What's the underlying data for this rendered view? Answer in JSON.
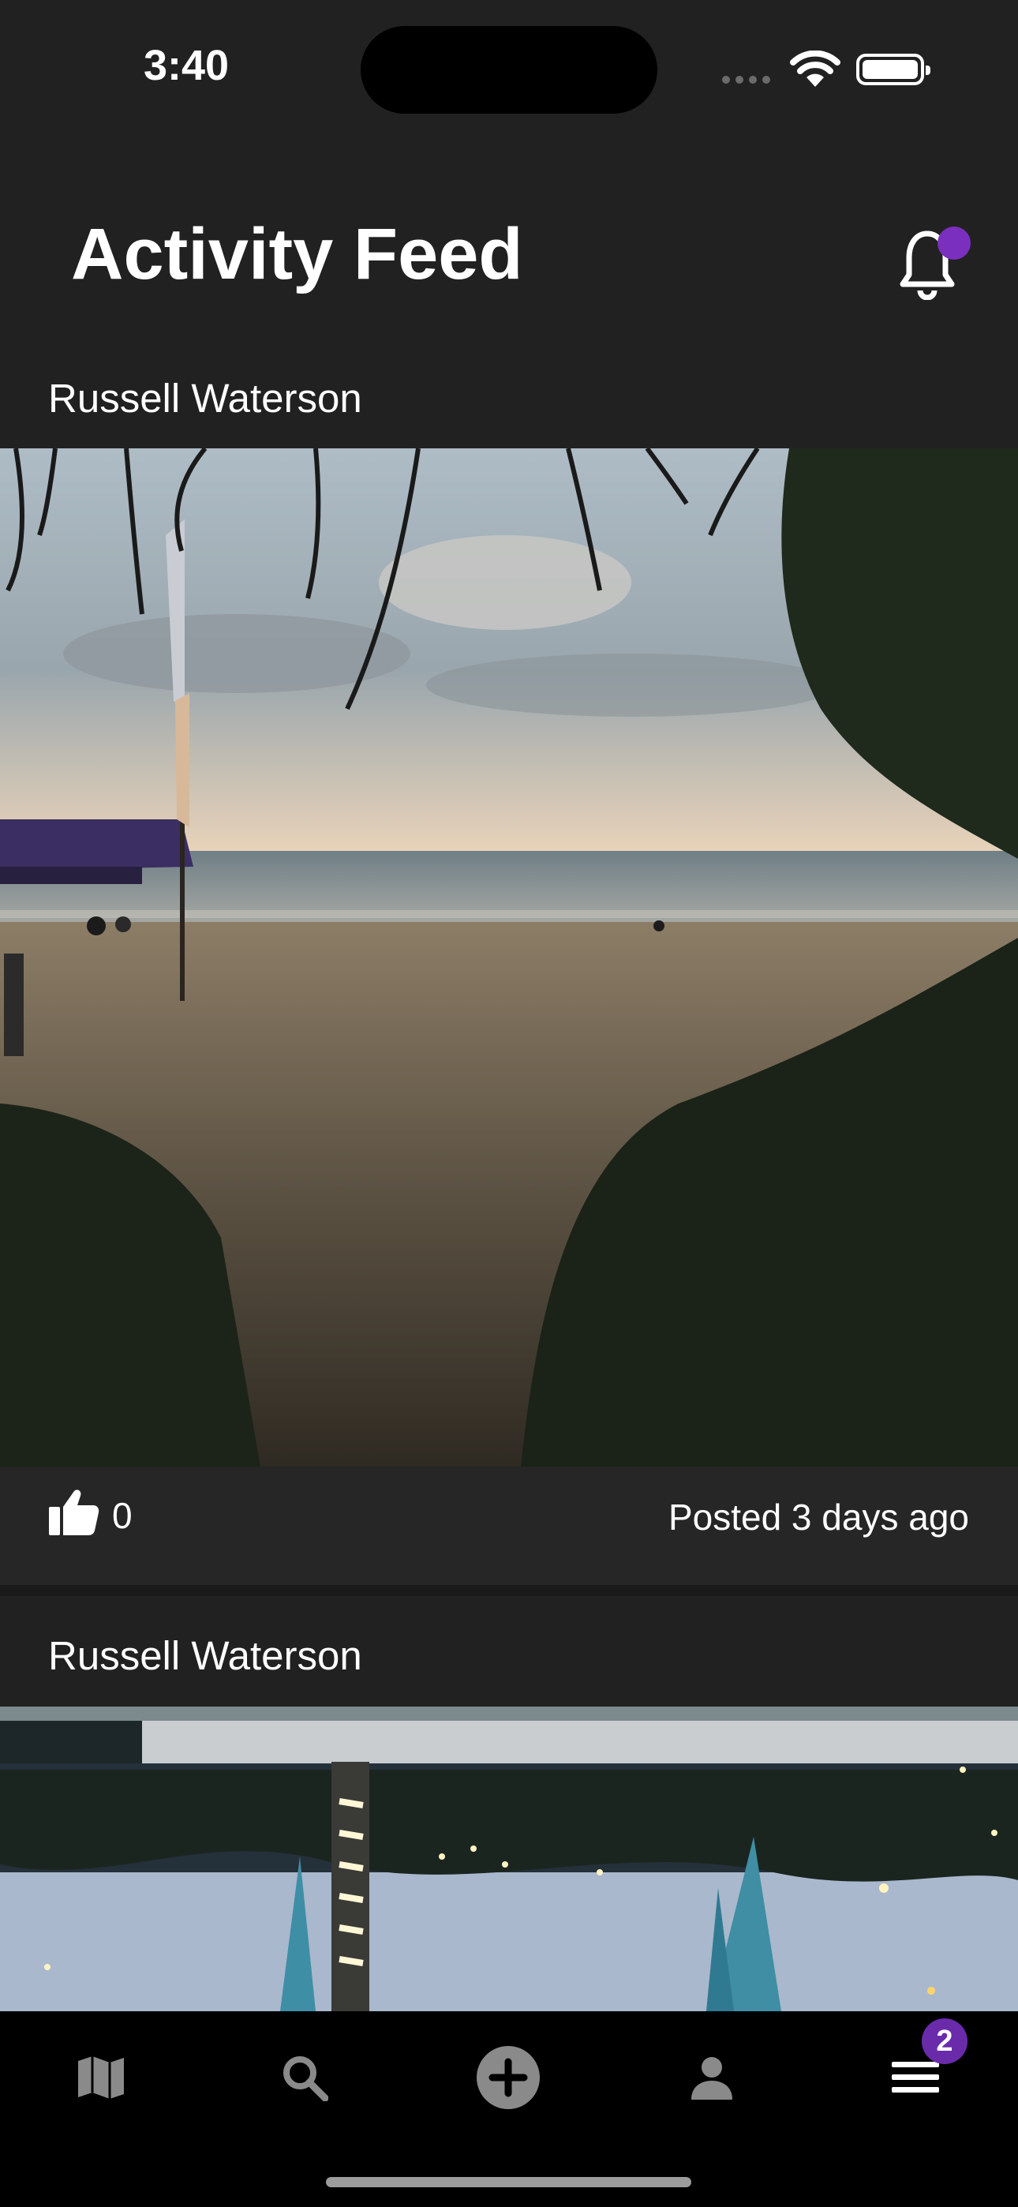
{
  "status": {
    "time": "3:40"
  },
  "header": {
    "title": "Activity Feed"
  },
  "posts": [
    {
      "author": "Russell Waterson",
      "likes": "0",
      "posted": "Posted 3 days ago"
    },
    {
      "author": "Russell Waterson"
    }
  ],
  "tabbar": {
    "items": [
      "map-icon",
      "search-icon",
      "add-icon",
      "profile-icon",
      "menu-icon"
    ],
    "menu_badge": "2"
  },
  "colors": {
    "accent": "#7b2fbf",
    "background": "#212121",
    "tabbar": "#000000"
  }
}
